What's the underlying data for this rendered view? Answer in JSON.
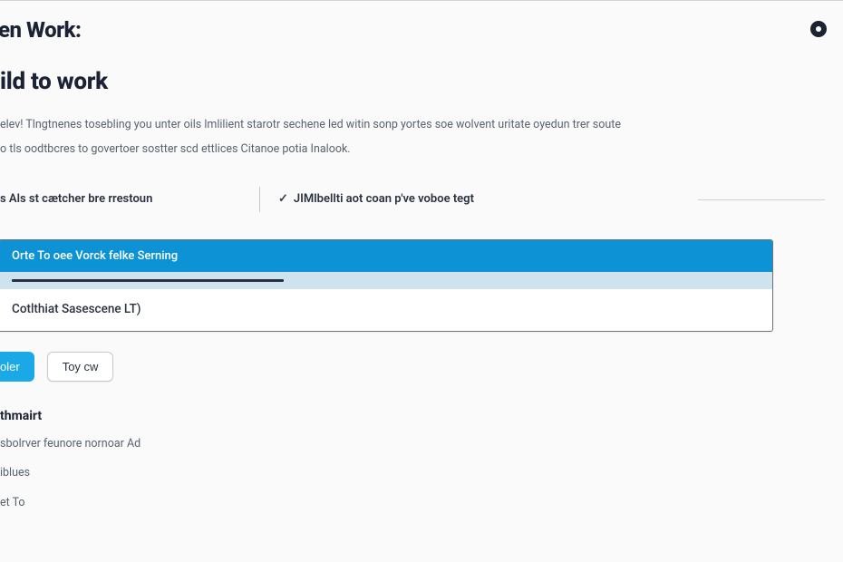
{
  "header": {
    "brand": "en Work:"
  },
  "page": {
    "title": "ild to work",
    "paragraph1": "elev! Tlngtnenes tosebling you unter oils lmlilient starotr sechene led witin sonp yortes soe wolvent uritate oyedun trer soute",
    "paragraph2": "o tls oodtbcres to govertoer sostter scd ettlices Citanoe potia Inalook."
  },
  "tabs": {
    "left": "s Als st cætcher bre rrestoun",
    "right": "JIMlbellti aot coan p've voboe tegt"
  },
  "dropdown": {
    "header": "Orte To oee Vorck felke Serning",
    "item": "Cotlthiat Sasescene LT)"
  },
  "buttons": {
    "primary": "oler",
    "secondary": "Toy cw"
  },
  "section": {
    "heading": "thmairt",
    "item1": "sbolrver feunore nornoar Ad",
    "item2": "iblues",
    "item3": "et To"
  }
}
